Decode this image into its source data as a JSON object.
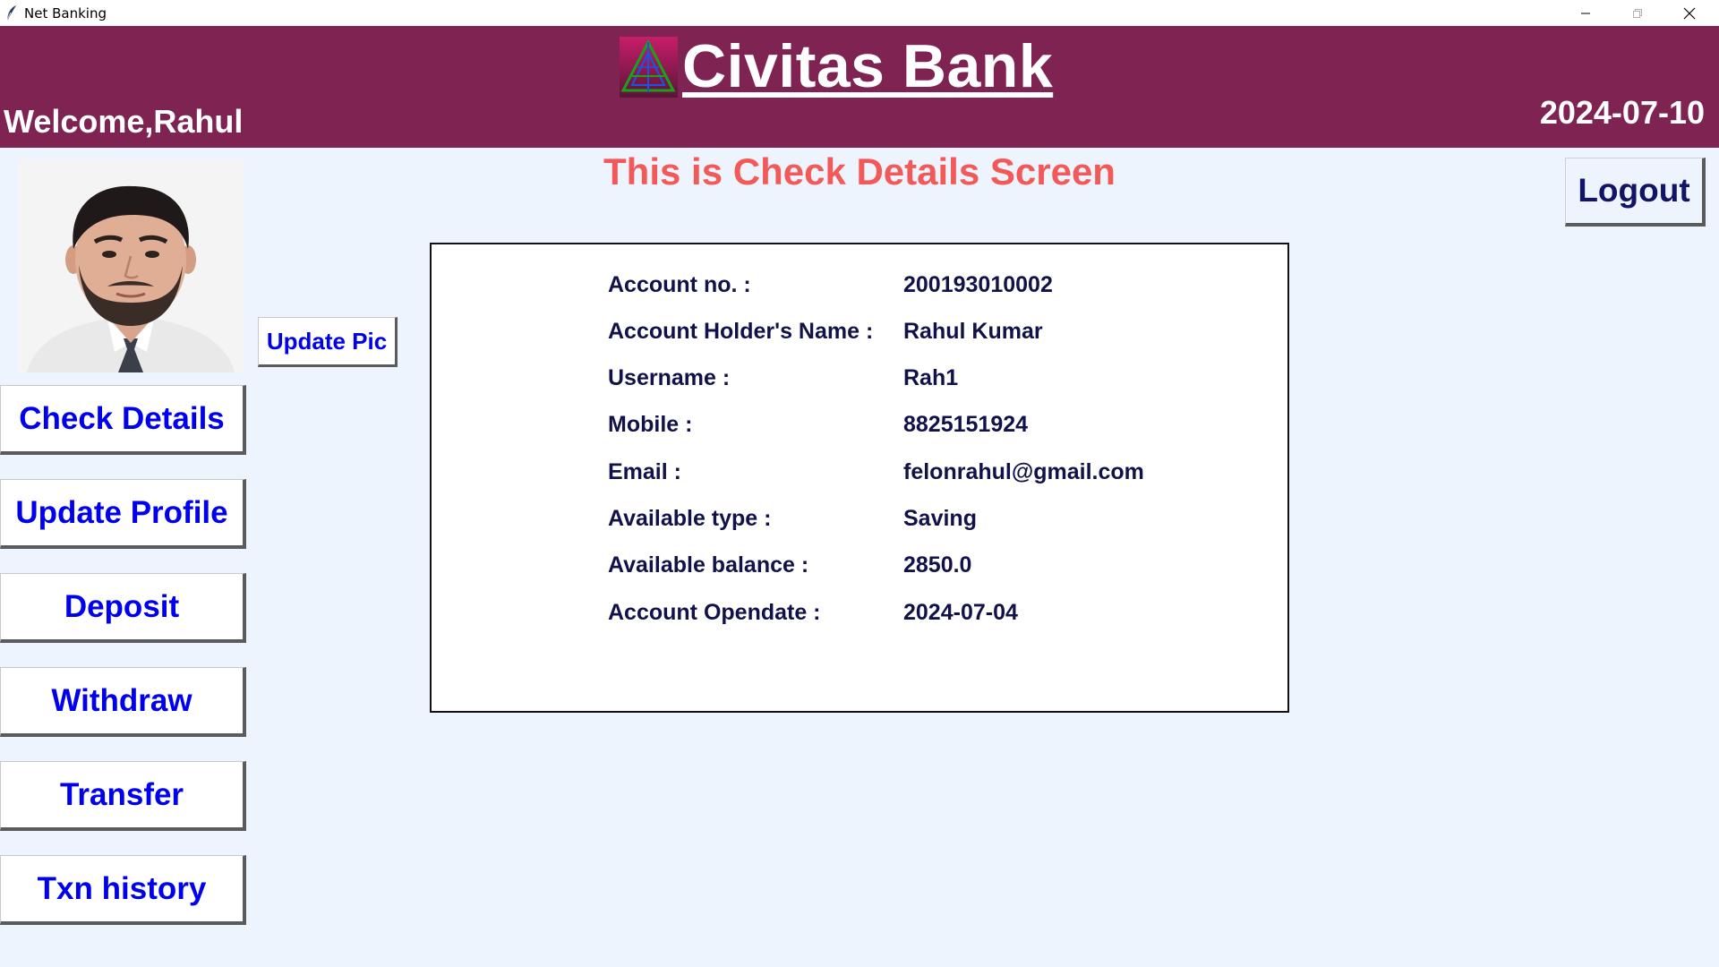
{
  "window": {
    "title": "Net Banking",
    "icon": "feather-icon",
    "controls": [
      "minimize-icon",
      "maximize-icon",
      "close-icon"
    ]
  },
  "header": {
    "bank_name": "Civitas Bank",
    "welcome": "Welcome,Rahul",
    "date": "2024-07-10",
    "background_color": "#7f2353"
  },
  "screen_title": "This is Check Details Screen",
  "profile": {
    "photo": "profile-photo",
    "update_pic_label": "Update Pic"
  },
  "sidebar": {
    "items": [
      {
        "label": "Check Details"
      },
      {
        "label": "Update Profile"
      },
      {
        "label": "Deposit"
      },
      {
        "label": "Withdraw"
      },
      {
        "label": "Transfer"
      },
      {
        "label": "Txn history"
      }
    ]
  },
  "logout_label": "Logout",
  "details": [
    {
      "label": "Account no. :",
      "value": "200193010002"
    },
    {
      "label": "Account Holder's Name :",
      "value": "Rahul Kumar"
    },
    {
      "label": "Username :",
      "value": "Rah1"
    },
    {
      "label": "Mobile :",
      "value": "8825151924"
    },
    {
      "label": "Email :",
      "value": "felonrahul@gmail.com"
    },
    {
      "label": "Available type :",
      "value": "Saving"
    },
    {
      "label": "Available balance :",
      "value": "2850.0"
    },
    {
      "label": "Account Opendate :",
      "value": "2024-07-04"
    }
  ],
  "colors": {
    "button_text": "#0000ee",
    "screen_title": "#f25a5a",
    "page_background": "#eef4fd",
    "detail_text": "#12124a"
  }
}
